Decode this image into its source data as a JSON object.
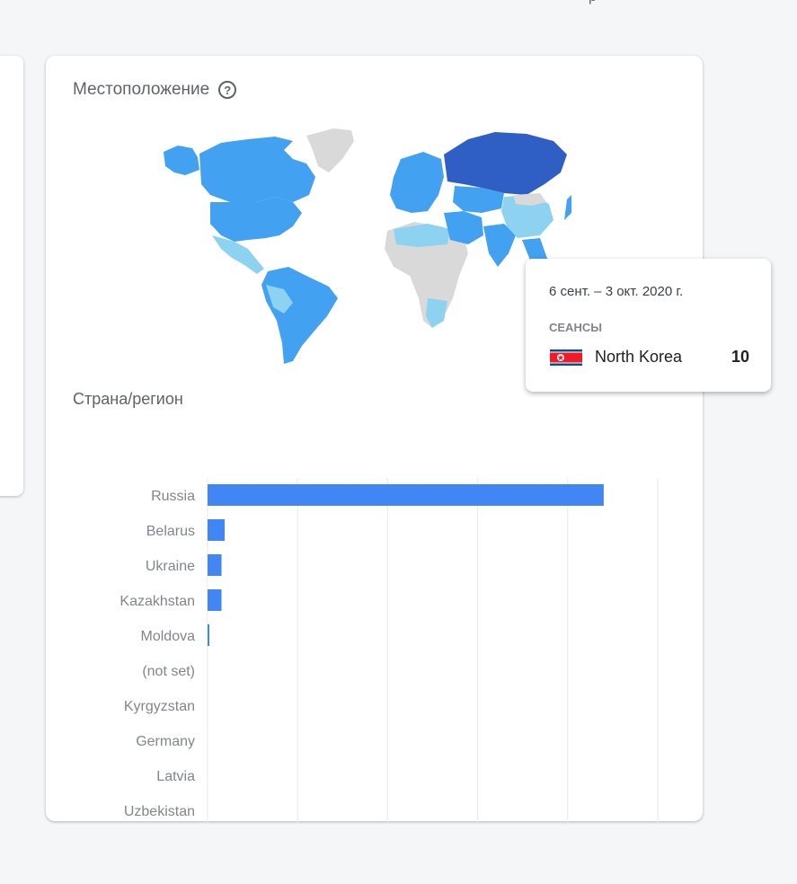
{
  "location_card": {
    "title": "Местоположение",
    "help_icon": "question-circle-icon",
    "section_title": "Страна/регион"
  },
  "top_fragment": "р",
  "tooltip": {
    "date_range": "6 сент. – 3 окт. 2020 г.",
    "metric_label": "СЕАНСЫ",
    "country": "North Korea",
    "value": "10",
    "flag_icon": "north-korea-flag-icon"
  },
  "colors": {
    "bar": "#4285f4",
    "map_strong": "#2f5ec4",
    "map_medium": "#42a1f0",
    "map_light": "#8dd2f0",
    "map_none": "#d9d9d9"
  },
  "chart_data": {
    "type": "bar",
    "orientation": "horizontal",
    "categories": [
      "Russia",
      "Belarus",
      "Ukraine",
      "Kazakhstan",
      "Moldova",
      "(not set)",
      "Kyrgyzstan",
      "Germany",
      "Latvia",
      "Uzbekistan"
    ],
    "values": [
      88,
      3.8,
      3.1,
      3.1,
      0.4,
      0,
      0,
      0,
      0,
      0
    ],
    "xlim": [
      0,
      100
    ],
    "x_ticks": [
      "0 %",
      "20 %",
      "40 %",
      "60 %",
      "80 %",
      "100 %"
    ],
    "grid": true
  }
}
